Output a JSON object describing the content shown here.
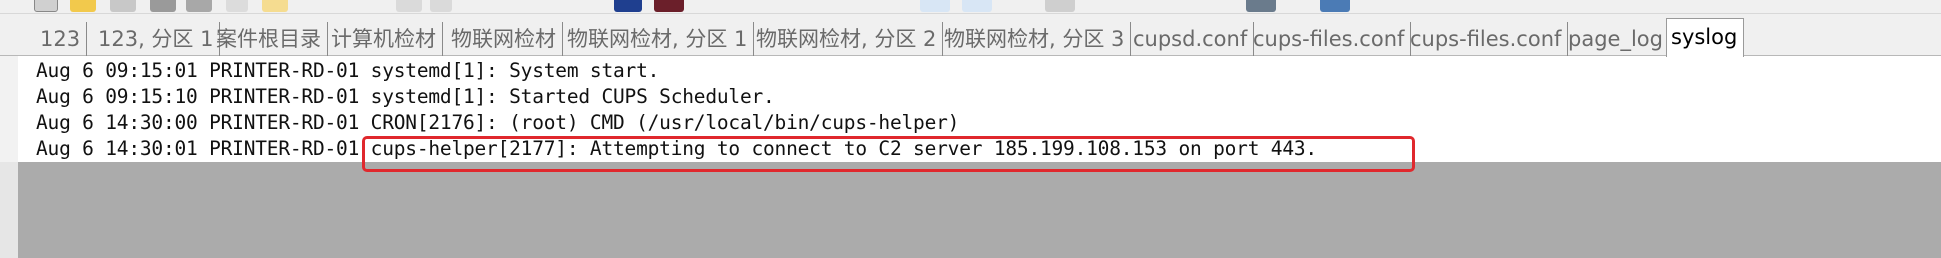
{
  "tabs": [
    {
      "label": "123"
    },
    {
      "label": "123, 分区 1"
    },
    {
      "label": "案件根目录"
    },
    {
      "label": "计算机检材"
    },
    {
      "label": "物联网检材"
    },
    {
      "label": "物联网检材, 分区 1"
    },
    {
      "label": "物联网检材, 分区 2"
    },
    {
      "label": "物联网检材, 分区 3"
    },
    {
      "label": "cupsd.conf"
    },
    {
      "label": "cups-files.conf"
    },
    {
      "label": "cups-files.conf"
    },
    {
      "label": "page_log"
    },
    {
      "label": "syslog",
      "active": true
    }
  ],
  "log_lines": [
    "Aug 6 09:15:01 PRINTER-RD-01 systemd[1]: System start.",
    "Aug 6 09:15:10 PRINTER-RD-01 systemd[1]: Started CUPS Scheduler.",
    "Aug 6 14:30:00 PRINTER-RD-01 CRON[2176]: (root) CMD (/usr/local/bin/cups-helper)",
    "Aug 6 14:30:01 PRINTER-RD-01 cups-helper[2177]: Attempting to connect to C2 server 185.199.108.153 on port 443."
  ],
  "colors": {
    "highlight": "#e0282d",
    "empty_area": "#ababab",
    "tab_bar": "#f0f0f0"
  }
}
